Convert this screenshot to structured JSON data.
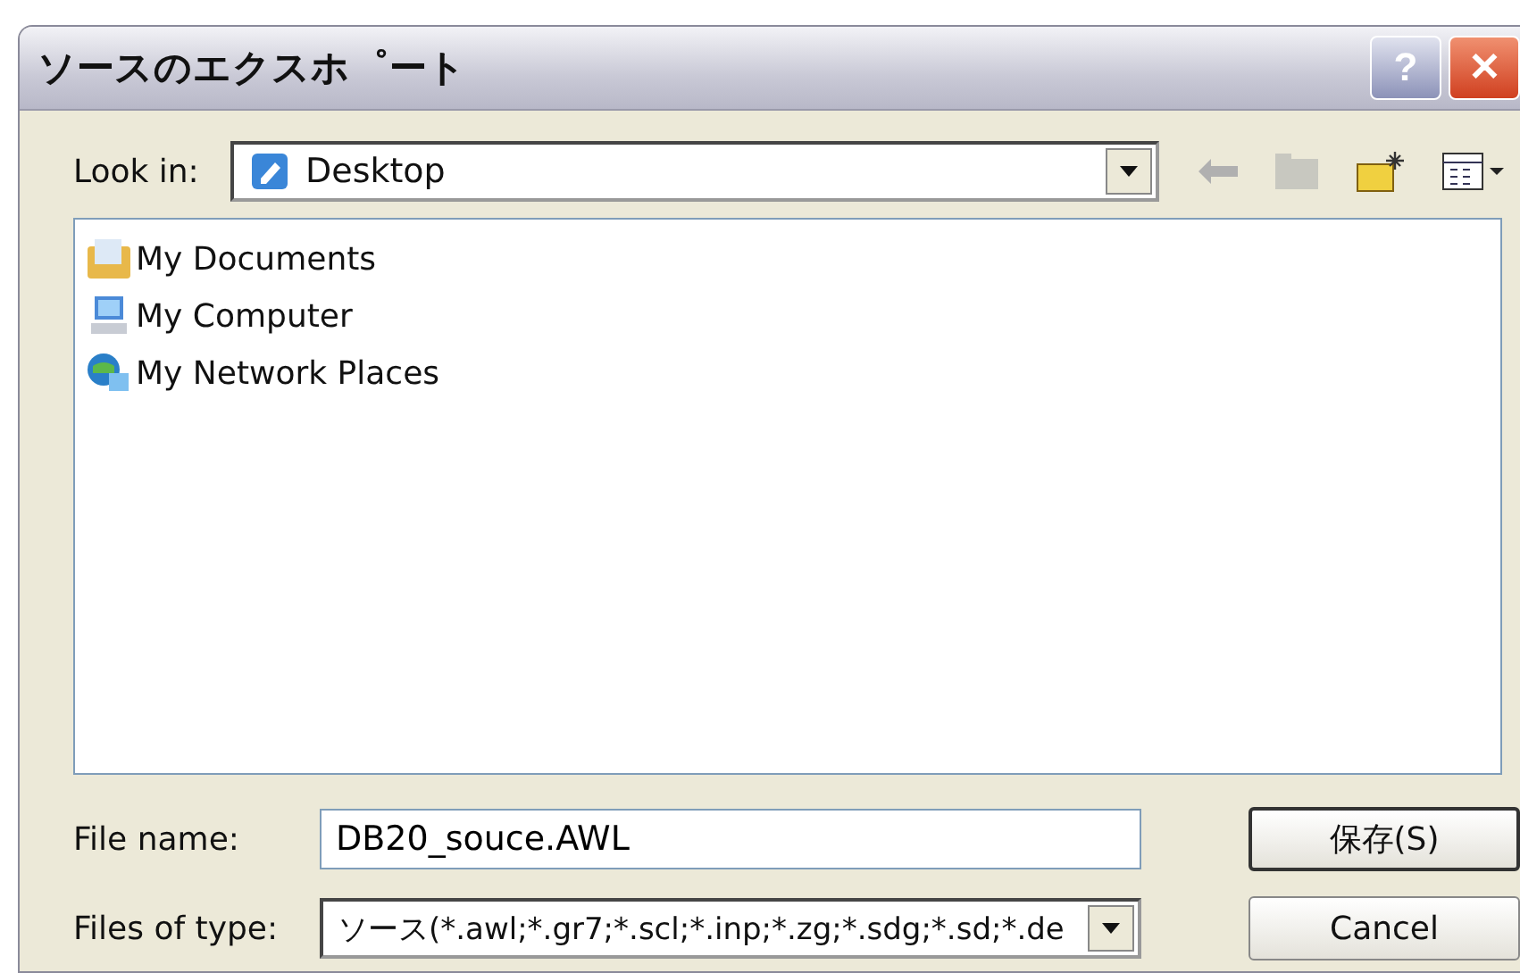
{
  "window": {
    "title": "ソースのエクスホ゜ート",
    "buttons": [
      {
        "kind": "help",
        "label": "?"
      },
      {
        "kind": "close",
        "label": "✕"
      }
    ]
  },
  "look_in": {
    "label": "Look in:",
    "value": "Desktop"
  },
  "files": [
    {
      "name": "My Documents",
      "kind": "documents"
    },
    {
      "name": "My Computer",
      "kind": "computer"
    },
    {
      "name": "My Network Places",
      "kind": "network"
    }
  ],
  "file_name": {
    "label": "File name:",
    "value": "DB20_souce.AWL"
  },
  "file_type": {
    "label": "Files of type:",
    "value": "ソース(*.awl;*.gr7;*.scl;*.inp;*.zg;*.sdg;*.sd;*.de"
  },
  "buttons": [
    {
      "label": "保存(S)",
      "default": true
    },
    {
      "label": "Cancel",
      "default": false
    }
  ]
}
